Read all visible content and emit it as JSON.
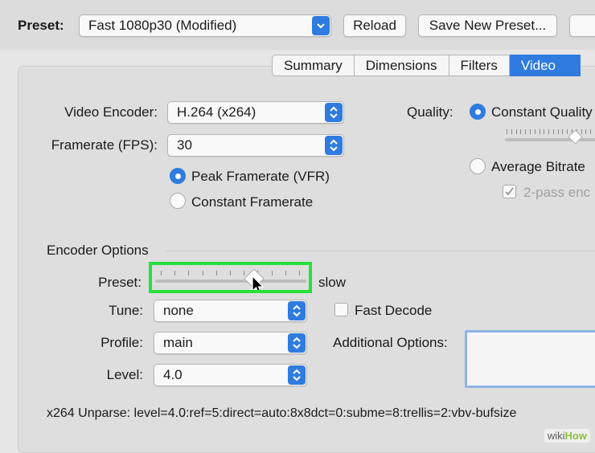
{
  "toolbar": {
    "preset_label": "Preset:",
    "preset_value": "Fast 1080p30 (Modified)",
    "reload_label": "Reload",
    "save_preset_label": "Save New Preset..."
  },
  "tabs": [
    {
      "label": "Summary",
      "active": false
    },
    {
      "label": "Dimensions",
      "active": false
    },
    {
      "label": "Filters",
      "active": false
    },
    {
      "label": "Video",
      "active": true
    }
  ],
  "video": {
    "encoder_label": "Video Encoder:",
    "encoder_value": "H.264 (x264)",
    "framerate_label": "Framerate (FPS):",
    "framerate_value": "30",
    "peak_framerate_label": "Peak Framerate (VFR)",
    "constant_framerate_label": "Constant Framerate",
    "quality_label": "Quality:",
    "constant_quality_label": "Constant Quality",
    "average_bitrate_label": "Average Bitrate",
    "two_pass_label": "2-pass enc"
  },
  "encoder_options": {
    "section_title": "Encoder Options",
    "preset_label": "Preset:",
    "preset_slider_value_label": "slow",
    "tune_label": "Tune:",
    "tune_value": "none",
    "fast_decode_label": "Fast Decode",
    "profile_label": "Profile:",
    "profile_value": "main",
    "additional_options_label": "Additional Options:",
    "level_label": "Level:",
    "level_value": "4.0"
  },
  "unparse_text": "x264 Unparse: level=4.0:ref=5:direct=auto:8x8dct=0:subme=8:trellis=2:vbv-bufsize",
  "watermark": {
    "wiki": "wiki",
    "how": "How"
  },
  "colors": {
    "accent": "#2f7be0",
    "highlight": "#27e03c"
  }
}
